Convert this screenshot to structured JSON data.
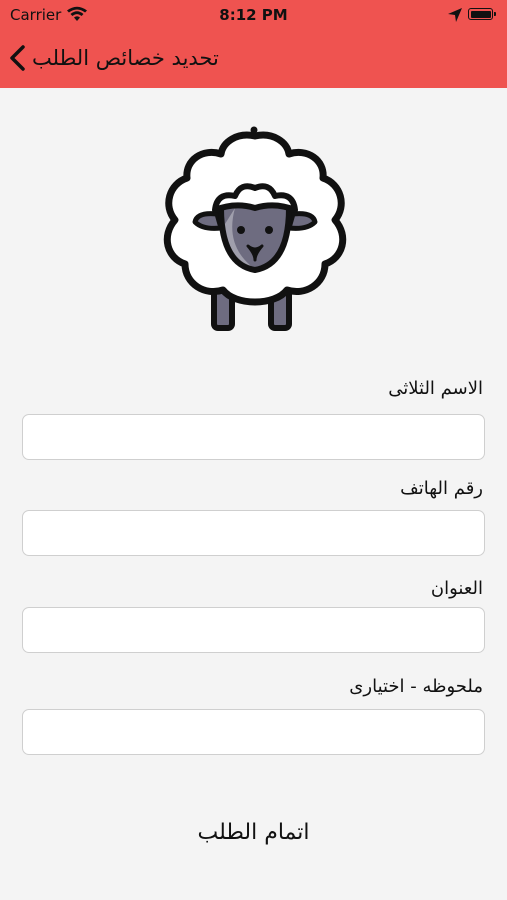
{
  "status_bar": {
    "carrier": "Carrier",
    "time": "8:12 PM"
  },
  "navbar": {
    "title": "تحديد خصائص الطلب"
  },
  "form": {
    "fields": [
      {
        "label": "الاسم الثلاثى",
        "value": ""
      },
      {
        "label": "رقم الهاتف",
        "value": ""
      },
      {
        "label": "العنوان",
        "value": ""
      },
      {
        "label": "ملحوظه - اختيارى",
        "value": ""
      }
    ],
    "submit_label": "اتمام الطلب"
  },
  "colors": {
    "header": "#ef5350",
    "background": "#f4f4f4",
    "sheep_face": "#6e6c80"
  },
  "icons": {
    "back": "chevron-left-icon",
    "illustration": "sheep-icon"
  }
}
